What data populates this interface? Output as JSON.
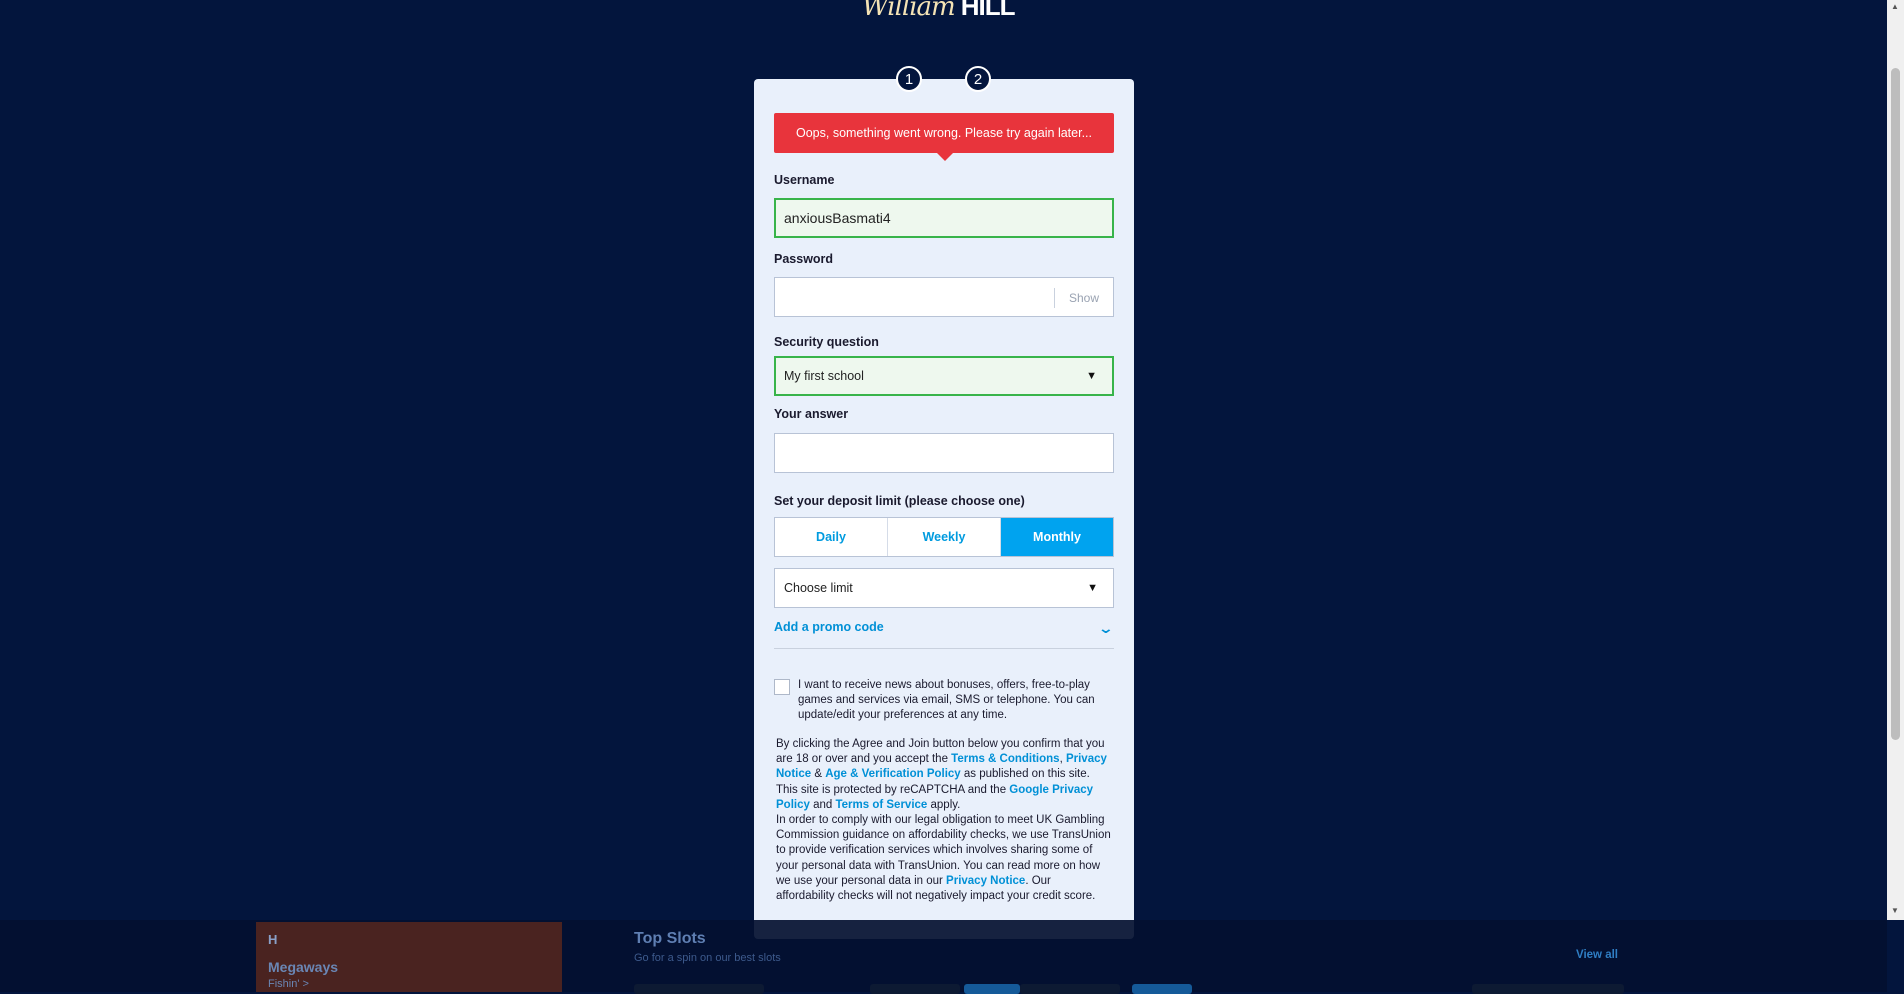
{
  "logo": {
    "script": "William",
    "caps": "HILL"
  },
  "steps": [
    "1",
    "2"
  ],
  "form": {
    "error_message": "Oops, something went wrong. Please try again later...",
    "username": {
      "label": "Username",
      "value": "anxiousBasmati4"
    },
    "password": {
      "label": "Password",
      "value": "",
      "show_label": "Show"
    },
    "security_question": {
      "label": "Security question",
      "selected": "My first school"
    },
    "answer": {
      "label": "Your answer",
      "value": ""
    },
    "deposit": {
      "label": "Set your deposit limit (please choose one)",
      "options": [
        "Daily",
        "Weekly",
        "Monthly"
      ],
      "selected": "Monthly",
      "limit_placeholder": "Choose limit"
    },
    "promo_label": "Add a promo code",
    "consent_text": "I want to receive news about bonuses, offers, free-to-play games and services via email, SMS or telephone. You can update/edit your preferences at any time.",
    "legal": {
      "p1_a": "By clicking the Agree and Join button below you confirm that you are 18 or over and you accept the ",
      "link_terms": "Terms & Conditions",
      "p1_b": ", ",
      "link_privacy": "Privacy Notice",
      "p1_c": " & ",
      "link_age": "Age & Verification Policy",
      "p1_d": " as published on this site. This site is protected by reCAPTCHA and the ",
      "link_google_privacy": "Google Privacy Policy",
      "p1_e": " and ",
      "link_tos": "Terms of Service",
      "p1_f": " apply.",
      "p2_a": "In order to comply with our legal obligation to meet UK Gambling Commission guidance on affordability checks, we use TransUnion to provide verification services which involves sharing some of your personal data with TransUnion. You can read more on how we use your personal data in our ",
      "link_privacy2": "Privacy Notice",
      "p2_b": ". Our affordability checks will not negatively impact your credit score."
    }
  },
  "bottom_strip": {
    "tile_brand": "H",
    "tile_name": "Megaways",
    "tile_sub": "Fishin' >",
    "title": "Top Slots",
    "subtitle": "Go for a spin on our best slots",
    "view_all": "View all"
  }
}
